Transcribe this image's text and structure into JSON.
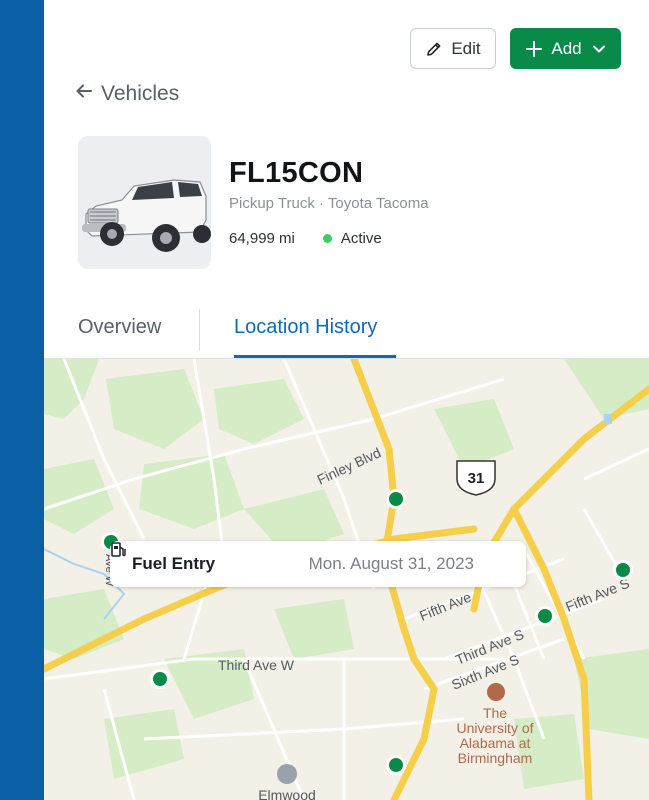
{
  "header": {
    "edit_label": "Edit",
    "add_label": "Add"
  },
  "breadcrumb": {
    "back_label": "Vehicles"
  },
  "vehicle": {
    "plate": "FL15CON",
    "subtitle": "Pickup Truck · Toyota Tacoma",
    "mileage": "64,999 mi",
    "status": "Active"
  },
  "tabs": [
    {
      "label": "Overview"
    },
    {
      "label": "Location History"
    }
  ],
  "map": {
    "callout": {
      "title": "Fuel Entry",
      "date": "Mon. August 31, 2023"
    },
    "labels": {
      "finley": "Finley Blvd",
      "hwy": "31",
      "ave_w": "Ave W",
      "fifth_ave": "Fifth Ave",
      "fifth_ave_s": "Fifth Ave S",
      "third_ave_s": "Third Ave S",
      "sixth_ave_s": "Sixth Ave S",
      "third_ave_w": "Third Ave W",
      "uab_1": "The",
      "uab_2": "University of",
      "uab_3": "Alabama at",
      "uab_4": "Birmingham",
      "elmwood": "Elmwood"
    }
  },
  "colors": {
    "sidebar": "#0b5fa5",
    "accent": "#0b6bb8",
    "add_button": "#0a8a48",
    "marker": "#0a8a48",
    "status_active": "#3ecc6b"
  },
  "icons": {
    "edit": "pencil-icon",
    "add": "plus-icon",
    "add_menu": "chevron-down-icon",
    "back": "arrow-left-icon",
    "fuel": "fuel-pump-icon"
  }
}
